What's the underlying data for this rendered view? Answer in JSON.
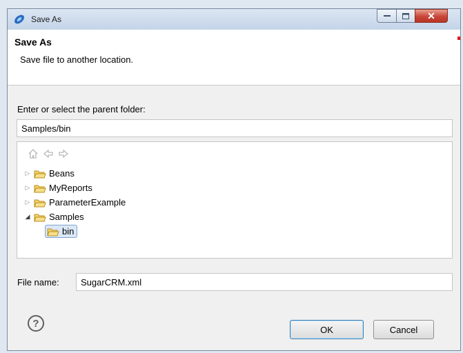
{
  "window": {
    "title": "Save As"
  },
  "header": {
    "title": "Save As",
    "description": "Save file to another location."
  },
  "parent": {
    "label": "Enter or select the parent folder:",
    "value": "Samples/bin"
  },
  "tree": {
    "items": [
      {
        "label": "Beans",
        "expanded": false
      },
      {
        "label": "MyReports",
        "expanded": false
      },
      {
        "label": "ParameterExample",
        "expanded": false
      },
      {
        "label": "Samples",
        "expanded": true
      },
      {
        "label": "bin",
        "selected": true
      }
    ]
  },
  "file": {
    "label": "File name:",
    "value": "SugarCRM.xml"
  },
  "buttons": {
    "ok": "OK",
    "cancel": "Cancel",
    "help": "?"
  },
  "icons": [
    "app-icon",
    "minimize-icon",
    "maximize-icon",
    "close-icon",
    "home-icon",
    "back-arrow-icon",
    "forward-arrow-icon",
    "folder-icon",
    "help-icon"
  ],
  "colors": {
    "title_bar": "#c4d4e8",
    "close_button": "#c9463a",
    "selection": "#dbe8f8",
    "default_button_border": "#3c7fb1"
  }
}
